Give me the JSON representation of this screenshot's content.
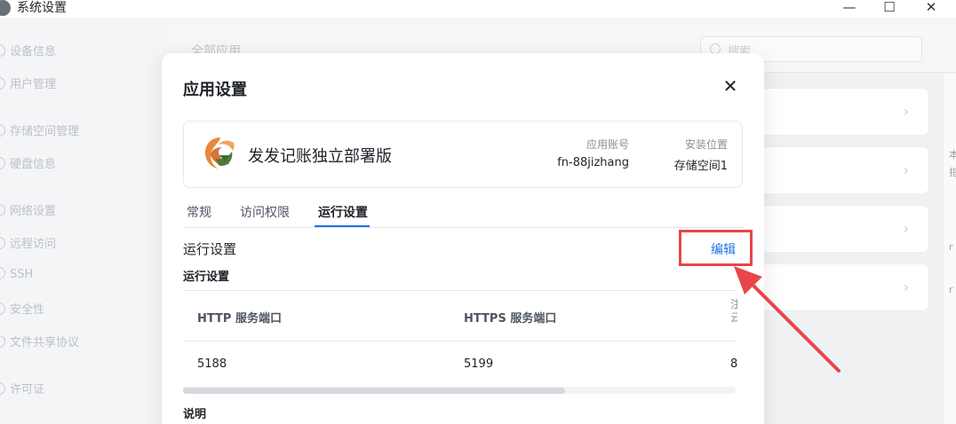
{
  "window": {
    "title": "系统设置",
    "controls": {
      "minimize": "—",
      "maximize": "☐",
      "close": "✕"
    }
  },
  "sidebar": {
    "items": [
      {
        "label": "设备信息",
        "icon": "info-icon"
      },
      {
        "label": "用户管理",
        "icon": "user-icon"
      },
      {
        "label": "存储空间管理",
        "icon": "storage-icon"
      },
      {
        "label": "硬盘信息",
        "icon": "disk-icon"
      },
      {
        "label": "网络设置",
        "icon": "network-icon"
      },
      {
        "label": "远程访问",
        "icon": "remote-icon"
      },
      {
        "label": "SSH",
        "icon": "ssh-icon"
      },
      {
        "label": "安全性",
        "icon": "shield-icon"
      },
      {
        "label": "文件共享协议",
        "icon": "share-icon"
      },
      {
        "label": "许可证",
        "icon": "license-icon"
      }
    ]
  },
  "content": {
    "title": "全部应用",
    "search_placeholder": "搜索",
    "edge_chars": [
      "本",
      "指",
      "r",
      "r"
    ]
  },
  "modal": {
    "title": "应用设置",
    "close": "✕",
    "app": {
      "name": "发发记账独立部署版",
      "account_label": "应用账号",
      "account_value": "fn-88jizhang",
      "location_label": "安装位置",
      "location_value": "存储空间1"
    },
    "tabs": [
      {
        "label": "常规",
        "active": false
      },
      {
        "label": "访问权限",
        "active": false
      },
      {
        "label": "运行设置",
        "active": true
      }
    ],
    "section_title": "运行设置",
    "edit_label": "编辑",
    "subsection_title": "运行设置",
    "table": {
      "headers": [
        "HTTP 服务端口",
        "HTTPS 服务端口"
      ],
      "clipped_header": "注\n云",
      "row": [
        "5188",
        "5199"
      ],
      "clipped_value": "8"
    },
    "notes_title": "说明"
  },
  "colors": {
    "accent": "#1a73e8",
    "annotation": "#e8464a"
  }
}
